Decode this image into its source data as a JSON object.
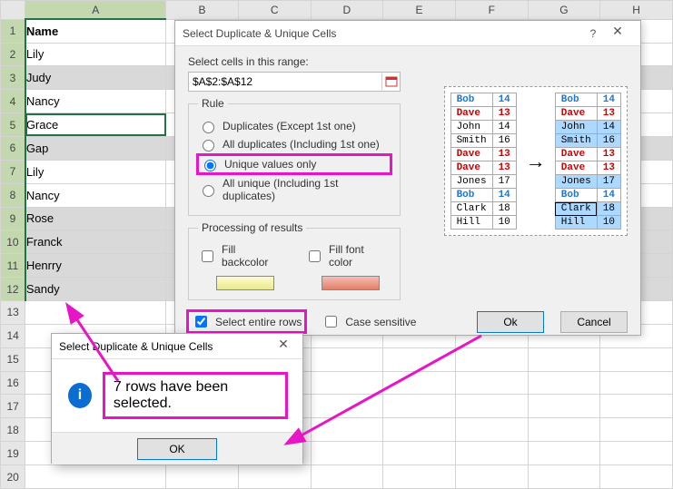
{
  "columns": [
    "A",
    "B",
    "C",
    "D",
    "E",
    "F",
    "G",
    "H"
  ],
  "rows_count": 20,
  "cellsA": [
    "Name",
    "Lily",
    "Judy",
    "Nancy",
    "Grace",
    "Gap",
    "Lily",
    "Nancy",
    "Rose",
    "Franck",
    "Henrry",
    "Sandy"
  ],
  "unique_rows": [
    3,
    6,
    9,
    10,
    11,
    12
  ],
  "active_row": 5,
  "dialog": {
    "title": "Select Duplicate & Unique Cells",
    "label_range": "Select cells in this range:",
    "range_value": "$A$2:$A$12",
    "rule_legend": "Rule",
    "opt1": "Duplicates (Except 1st one)",
    "opt2": "All duplicates (Including 1st one)",
    "opt3": "Unique values only",
    "opt4": "All unique (Including 1st duplicates)",
    "proc_legend": "Processing of results",
    "fill_back": "Fill backcolor",
    "fill_font": "Fill font color",
    "select_rows": "Select entire rows",
    "case_sens": "Case sensitive",
    "ok": "Ok",
    "cancel": "Cancel"
  },
  "preview": {
    "left": [
      [
        "Bob",
        "14",
        "blue"
      ],
      [
        "Dave",
        "13",
        "red"
      ],
      [
        "John",
        "14",
        ""
      ],
      [
        "Smith",
        "16",
        ""
      ],
      [
        "Dave",
        "13",
        "red"
      ],
      [
        "Dave",
        "13",
        "red"
      ],
      [
        "Jones",
        "17",
        ""
      ],
      [
        "Bob",
        "14",
        "blue"
      ],
      [
        "Clark",
        "18",
        ""
      ],
      [
        "Hill",
        "10",
        ""
      ]
    ],
    "right": [
      [
        "Bob",
        "14",
        "blue",
        0
      ],
      [
        "Dave",
        "13",
        "red",
        0
      ],
      [
        "John",
        "14",
        "",
        1
      ],
      [
        "Smith",
        "16",
        "",
        1
      ],
      [
        "Dave",
        "13",
        "red",
        0
      ],
      [
        "Dave",
        "13",
        "red",
        0
      ],
      [
        "Jones",
        "17",
        "",
        1
      ],
      [
        "Bob",
        "14",
        "blue",
        0
      ],
      [
        "Clark",
        "18",
        "",
        1
      ],
      [
        "Hill",
        "10",
        "",
        1
      ]
    ]
  },
  "msgbox": {
    "title": "Select Duplicate & Unique Cells",
    "text": "7 rows have been selected.",
    "ok": "OK"
  }
}
